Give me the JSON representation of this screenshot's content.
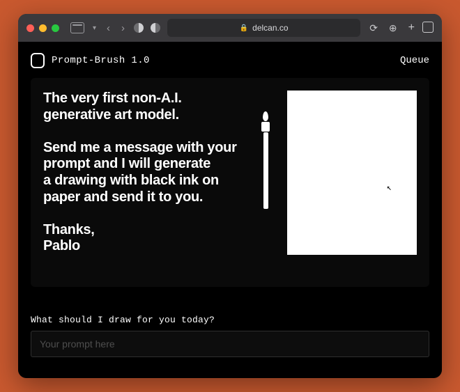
{
  "browser": {
    "url_host": "delcan.co"
  },
  "topbar": {
    "brand_name": "Prompt-Brush 1.0",
    "queue_label": "Queue"
  },
  "hero": {
    "text": "The very first non-A.I.\ngenerative art model.\n\nSend me a message with your\nprompt and I will generate\na drawing with black ink on\npaper and send it to you.\n\nThanks,\nPablo"
  },
  "prompt": {
    "label": "What should I draw for you today?",
    "placeholder": "Your prompt here",
    "value": ""
  },
  "colors": {
    "page_bg": "#000000",
    "window_frame": "#c9592f",
    "text": "#ffffff"
  }
}
